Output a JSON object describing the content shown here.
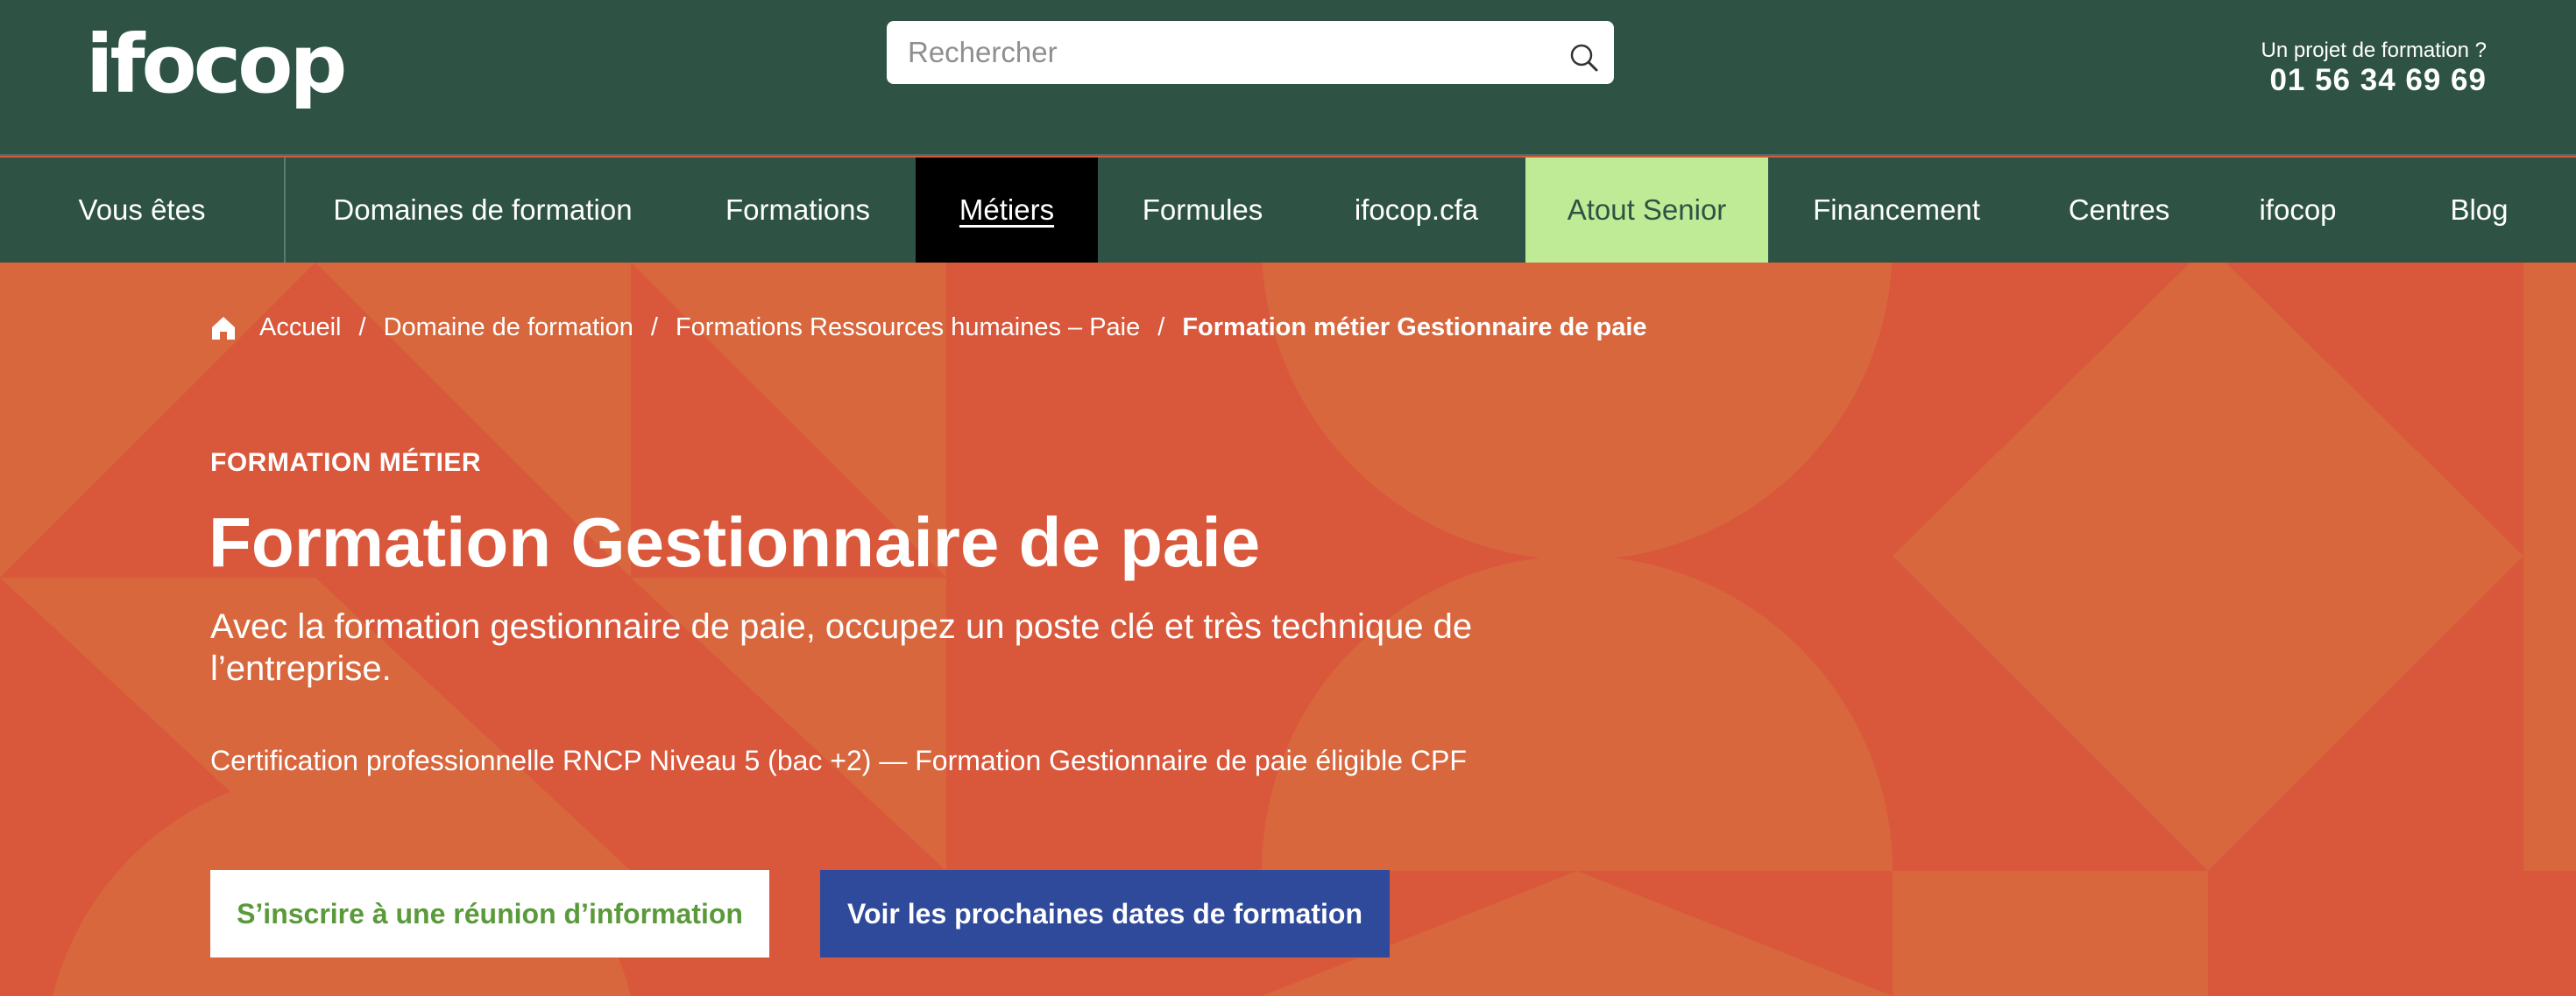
{
  "header": {
    "logo_text": "ifocop",
    "search_placeholder": "Rechercher",
    "contact_label": "Un projet de formation ?",
    "contact_phone": "01 56 34 69 69"
  },
  "nav": {
    "items": [
      {
        "label": "Vous êtes"
      },
      {
        "label": "Domaines de formation"
      },
      {
        "label": "Formations"
      },
      {
        "label": "Métiers"
      },
      {
        "label": "Formules"
      },
      {
        "label": "ifocop.cfa"
      },
      {
        "label": "Atout Senior"
      },
      {
        "label": "Financement"
      },
      {
        "label": "Centres"
      },
      {
        "label": "ifocop"
      },
      {
        "label": "Blog"
      }
    ],
    "active": "Métiers"
  },
  "breadcrumb": {
    "items": [
      "Accueil",
      "Domaine de formation",
      "Formations Ressources humaines – Paie"
    ],
    "current": "Formation métier Gestionnaire de paie",
    "separator": "/"
  },
  "hero": {
    "kicker": "FORMATION MÉTIER",
    "title": "Formation Gestionnaire de paie",
    "subtitle": "Avec la formation gestionnaire de paie, occupez un poste clé et très technique de l’entreprise.",
    "certification": "Certification professionnelle RNCP Niveau 5 (bac +2) — Formation Gestionnaire de paie éligible CPF",
    "btn_info": "S’inscrire à une réunion d’information",
    "btn_dates": "Voir les prochaines dates de formation"
  },
  "colors": {
    "header_bg": "#2e5345",
    "hero_bg": "#d9573a",
    "hero_shape": "#d8673e",
    "active_nav_bg": "#000000",
    "senior_nav_bg": "#c0eb96",
    "btn_info_text": "#5a9a3a",
    "btn_dates_bg": "#2f4a9a"
  },
  "icons": {
    "search": "search-icon",
    "breadcrumb_home": "home-icon"
  }
}
